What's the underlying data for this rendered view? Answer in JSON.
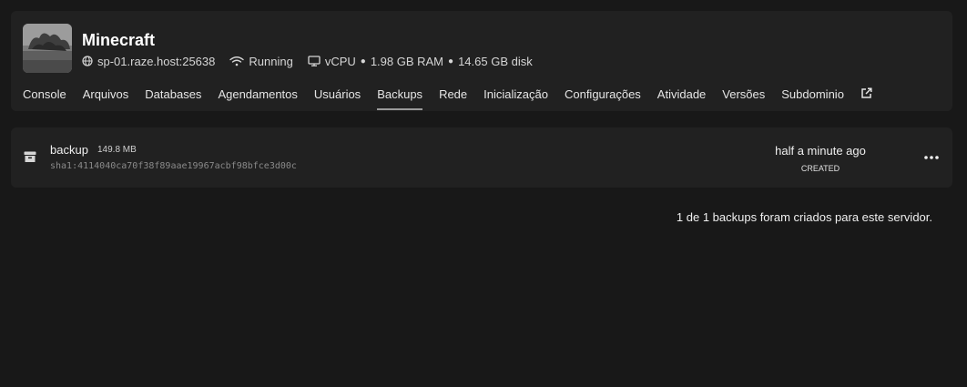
{
  "server": {
    "name": "Minecraft",
    "address": "sp-01.raze.host:25638",
    "status": "Running",
    "cpu": "vCPU",
    "ram": "1.98 GB RAM",
    "disk": "14.65 GB disk",
    "separator": "●"
  },
  "tabs": [
    "Console",
    "Arquivos",
    "Databases",
    "Agendamentos",
    "Usuários",
    "Backups",
    "Rede",
    "Inicialização",
    "Configurações",
    "Atividade",
    "Versões",
    "Subdominio"
  ],
  "active_tab": "Backups",
  "backup": {
    "name": "backup",
    "size": "149.8 MB",
    "hash": "sha1:4114040ca70f38f89aae19967acbf98bfce3d00c",
    "time": "half a minute ago",
    "status": "CREATED"
  },
  "footer": {
    "text": "1 de 1 backups foram criados para este servidor."
  },
  "colors": {
    "background": "#181818",
    "card": "#212121"
  }
}
